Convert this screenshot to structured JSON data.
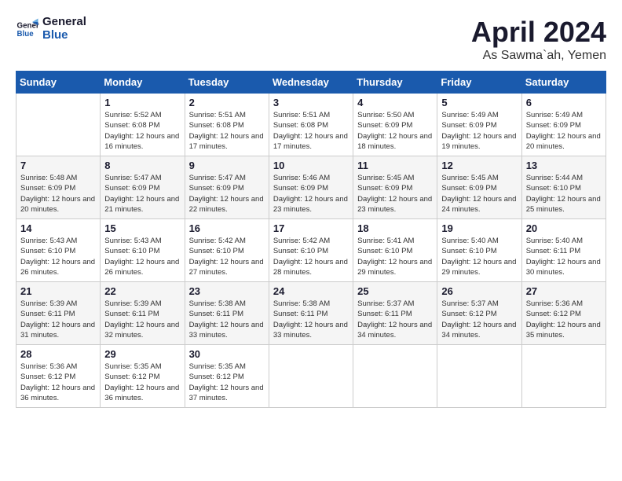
{
  "logo": {
    "line1": "General",
    "line2": "Blue"
  },
  "title": "April 2024",
  "location": "As Sawma`ah, Yemen",
  "weekdays": [
    "Sunday",
    "Monday",
    "Tuesday",
    "Wednesday",
    "Thursday",
    "Friday",
    "Saturday"
  ],
  "weeks": [
    [
      {
        "day": "",
        "sunrise": "",
        "sunset": "",
        "daylight": ""
      },
      {
        "day": "1",
        "sunrise": "Sunrise: 5:52 AM",
        "sunset": "Sunset: 6:08 PM",
        "daylight": "Daylight: 12 hours and 16 minutes."
      },
      {
        "day": "2",
        "sunrise": "Sunrise: 5:51 AM",
        "sunset": "Sunset: 6:08 PM",
        "daylight": "Daylight: 12 hours and 17 minutes."
      },
      {
        "day": "3",
        "sunrise": "Sunrise: 5:51 AM",
        "sunset": "Sunset: 6:08 PM",
        "daylight": "Daylight: 12 hours and 17 minutes."
      },
      {
        "day": "4",
        "sunrise": "Sunrise: 5:50 AM",
        "sunset": "Sunset: 6:09 PM",
        "daylight": "Daylight: 12 hours and 18 minutes."
      },
      {
        "day": "5",
        "sunrise": "Sunrise: 5:49 AM",
        "sunset": "Sunset: 6:09 PM",
        "daylight": "Daylight: 12 hours and 19 minutes."
      },
      {
        "day": "6",
        "sunrise": "Sunrise: 5:49 AM",
        "sunset": "Sunset: 6:09 PM",
        "daylight": "Daylight: 12 hours and 20 minutes."
      }
    ],
    [
      {
        "day": "7",
        "sunrise": "Sunrise: 5:48 AM",
        "sunset": "Sunset: 6:09 PM",
        "daylight": "Daylight: 12 hours and 20 minutes."
      },
      {
        "day": "8",
        "sunrise": "Sunrise: 5:47 AM",
        "sunset": "Sunset: 6:09 PM",
        "daylight": "Daylight: 12 hours and 21 minutes."
      },
      {
        "day": "9",
        "sunrise": "Sunrise: 5:47 AM",
        "sunset": "Sunset: 6:09 PM",
        "daylight": "Daylight: 12 hours and 22 minutes."
      },
      {
        "day": "10",
        "sunrise": "Sunrise: 5:46 AM",
        "sunset": "Sunset: 6:09 PM",
        "daylight": "Daylight: 12 hours and 23 minutes."
      },
      {
        "day": "11",
        "sunrise": "Sunrise: 5:45 AM",
        "sunset": "Sunset: 6:09 PM",
        "daylight": "Daylight: 12 hours and 23 minutes."
      },
      {
        "day": "12",
        "sunrise": "Sunrise: 5:45 AM",
        "sunset": "Sunset: 6:09 PM",
        "daylight": "Daylight: 12 hours and 24 minutes."
      },
      {
        "day": "13",
        "sunrise": "Sunrise: 5:44 AM",
        "sunset": "Sunset: 6:10 PM",
        "daylight": "Daylight: 12 hours and 25 minutes."
      }
    ],
    [
      {
        "day": "14",
        "sunrise": "Sunrise: 5:43 AM",
        "sunset": "Sunset: 6:10 PM",
        "daylight": "Daylight: 12 hours and 26 minutes."
      },
      {
        "day": "15",
        "sunrise": "Sunrise: 5:43 AM",
        "sunset": "Sunset: 6:10 PM",
        "daylight": "Daylight: 12 hours and 26 minutes."
      },
      {
        "day": "16",
        "sunrise": "Sunrise: 5:42 AM",
        "sunset": "Sunset: 6:10 PM",
        "daylight": "Daylight: 12 hours and 27 minutes."
      },
      {
        "day": "17",
        "sunrise": "Sunrise: 5:42 AM",
        "sunset": "Sunset: 6:10 PM",
        "daylight": "Daylight: 12 hours and 28 minutes."
      },
      {
        "day": "18",
        "sunrise": "Sunrise: 5:41 AM",
        "sunset": "Sunset: 6:10 PM",
        "daylight": "Daylight: 12 hours and 29 minutes."
      },
      {
        "day": "19",
        "sunrise": "Sunrise: 5:40 AM",
        "sunset": "Sunset: 6:10 PM",
        "daylight": "Daylight: 12 hours and 29 minutes."
      },
      {
        "day": "20",
        "sunrise": "Sunrise: 5:40 AM",
        "sunset": "Sunset: 6:11 PM",
        "daylight": "Daylight: 12 hours and 30 minutes."
      }
    ],
    [
      {
        "day": "21",
        "sunrise": "Sunrise: 5:39 AM",
        "sunset": "Sunset: 6:11 PM",
        "daylight": "Daylight: 12 hours and 31 minutes."
      },
      {
        "day": "22",
        "sunrise": "Sunrise: 5:39 AM",
        "sunset": "Sunset: 6:11 PM",
        "daylight": "Daylight: 12 hours and 32 minutes."
      },
      {
        "day": "23",
        "sunrise": "Sunrise: 5:38 AM",
        "sunset": "Sunset: 6:11 PM",
        "daylight": "Daylight: 12 hours and 33 minutes."
      },
      {
        "day": "24",
        "sunrise": "Sunrise: 5:38 AM",
        "sunset": "Sunset: 6:11 PM",
        "daylight": "Daylight: 12 hours and 33 minutes."
      },
      {
        "day": "25",
        "sunrise": "Sunrise: 5:37 AM",
        "sunset": "Sunset: 6:11 PM",
        "daylight": "Daylight: 12 hours and 34 minutes."
      },
      {
        "day": "26",
        "sunrise": "Sunrise: 5:37 AM",
        "sunset": "Sunset: 6:12 PM",
        "daylight": "Daylight: 12 hours and 34 minutes."
      },
      {
        "day": "27",
        "sunrise": "Sunrise: 5:36 AM",
        "sunset": "Sunset: 6:12 PM",
        "daylight": "Daylight: 12 hours and 35 minutes."
      }
    ],
    [
      {
        "day": "28",
        "sunrise": "Sunrise: 5:36 AM",
        "sunset": "Sunset: 6:12 PM",
        "daylight": "Daylight: 12 hours and 36 minutes."
      },
      {
        "day": "29",
        "sunrise": "Sunrise: 5:35 AM",
        "sunset": "Sunset: 6:12 PM",
        "daylight": "Daylight: 12 hours and 36 minutes."
      },
      {
        "day": "30",
        "sunrise": "Sunrise: 5:35 AM",
        "sunset": "Sunset: 6:12 PM",
        "daylight": "Daylight: 12 hours and 37 minutes."
      },
      {
        "day": "",
        "sunrise": "",
        "sunset": "",
        "daylight": ""
      },
      {
        "day": "",
        "sunrise": "",
        "sunset": "",
        "daylight": ""
      },
      {
        "day": "",
        "sunrise": "",
        "sunset": "",
        "daylight": ""
      },
      {
        "day": "",
        "sunrise": "",
        "sunset": "",
        "daylight": ""
      }
    ]
  ]
}
